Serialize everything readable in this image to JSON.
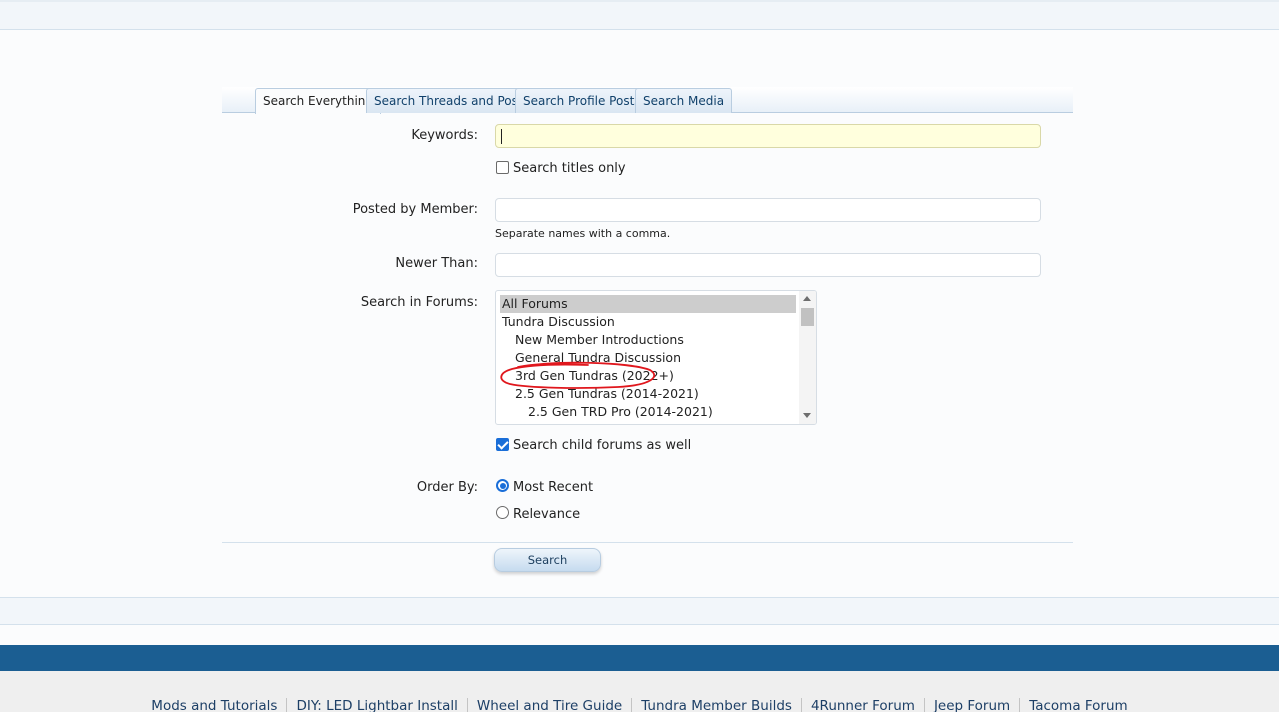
{
  "tabs": [
    {
      "label": "Search Everything",
      "active": true
    },
    {
      "label": "Search Threads and Posts",
      "active": false
    },
    {
      "label": "Search Profile Posts",
      "active": false
    },
    {
      "label": "Search Media",
      "active": false
    }
  ],
  "form": {
    "keywords_label": "Keywords:",
    "keywords_value": "",
    "titles_only_label": "Search titles only",
    "titles_only_checked": false,
    "member_label": "Posted by Member:",
    "member_value": "",
    "member_hint": "Separate names with a comma.",
    "newer_than_label": "Newer Than:",
    "newer_than_value": "",
    "forums_label": "Search in Forums:",
    "forums": [
      {
        "label": "All Forums",
        "selected": true
      },
      {
        "label": "Tundra Discussion",
        "selected": false
      },
      {
        "label": "New Member Introductions",
        "selected": false
      },
      {
        "label": "General Tundra Discussion",
        "selected": false
      },
      {
        "label": "3rd Gen Tundras (2022+)",
        "selected": false
      },
      {
        "label": "2.5 Gen Tundras (2014-2021)",
        "selected": false
      },
      {
        "label": "2.5 Gen TRD Pro (2014-2021)",
        "selected": false
      }
    ],
    "child_forums_label": "Search child forums as well",
    "child_forums_checked": true,
    "order_by_label": "Order By:",
    "order_most_recent": "Most Recent",
    "order_relevance": "Relevance",
    "order_selected": "Most Recent",
    "search_button": "Search"
  },
  "footer_links": [
    "Mods and Tutorials",
    "DIY: LED Lightbar Install",
    "Wheel and Tire Guide",
    "Tundra Member Builds",
    "4Runner Forum",
    "Jeep Forum",
    "Tacoma Forum"
  ],
  "colors": {
    "accent_blue": "#1b5e92",
    "focused_input": "#ffffdd",
    "annotation_red": "#e0171d"
  }
}
